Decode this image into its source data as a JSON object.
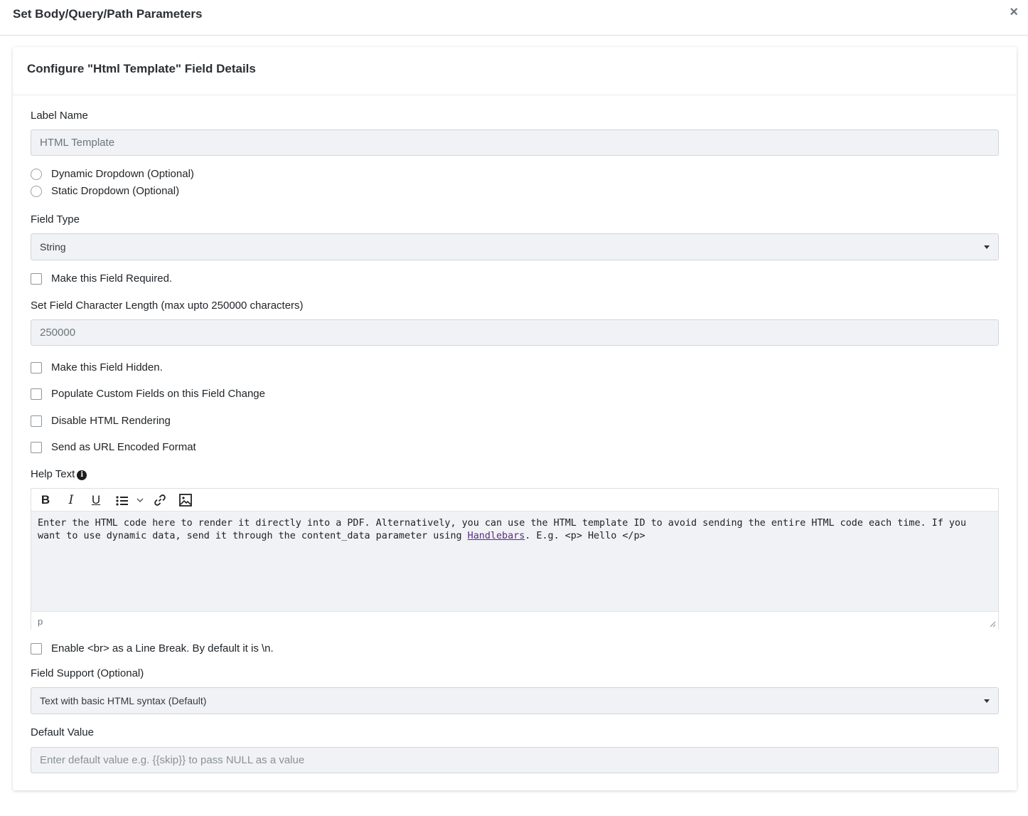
{
  "modal": {
    "title": "Set Body/Query/Path Parameters",
    "close_label": "×"
  },
  "card": {
    "title": "Configure \"Html Template\" Field Details"
  },
  "label_name": {
    "label": "Label Name",
    "value": "HTML Template"
  },
  "radios": [
    {
      "label": "Dynamic Dropdown (Optional)",
      "checked": false
    },
    {
      "label": "Static Dropdown (Optional)",
      "checked": false
    }
  ],
  "field_type": {
    "label": "Field Type",
    "selected": "String"
  },
  "required_checkbox": {
    "label": "Make this Field Required.",
    "checked": false
  },
  "char_length": {
    "label": "Set Field Character Length (max upto 250000 characters)",
    "value": "250000"
  },
  "options": [
    {
      "label": "Make this Field Hidden.",
      "checked": false
    },
    {
      "label": "Populate Custom Fields on this Field Change",
      "checked": false
    },
    {
      "label": "Disable HTML Rendering",
      "checked": false
    },
    {
      "label": "Send as URL Encoded Format",
      "checked": false
    }
  ],
  "help_text": {
    "label": "Help Text",
    "info_icon": "info-circle-icon",
    "toolbar": [
      "bold-icon",
      "italic-icon",
      "underline-icon",
      "bullet-list-icon",
      "chevron-down-icon",
      "link-icon",
      "image-icon"
    ],
    "content_before": "Enter the HTML code here to render it directly into a PDF. Alternatively, you can use the HTML template ID to avoid sending the entire HTML code each time. If you want to use dynamic data, send it through the content_data parameter using ",
    "link_text": "Handlebars",
    "content_after": ". E.g. <p> Hello </p>",
    "status_path": "p"
  },
  "line_break_checkbox": {
    "label": "Enable <br> as a Line Break. By default it is \\n.",
    "checked": false
  },
  "field_support": {
    "label": "Field Support (Optional)",
    "selected": "Text with basic HTML syntax (Default)"
  },
  "default_value": {
    "label": "Default Value",
    "placeholder": "Enter default value e.g. {{skip}} to pass NULL as a value"
  }
}
